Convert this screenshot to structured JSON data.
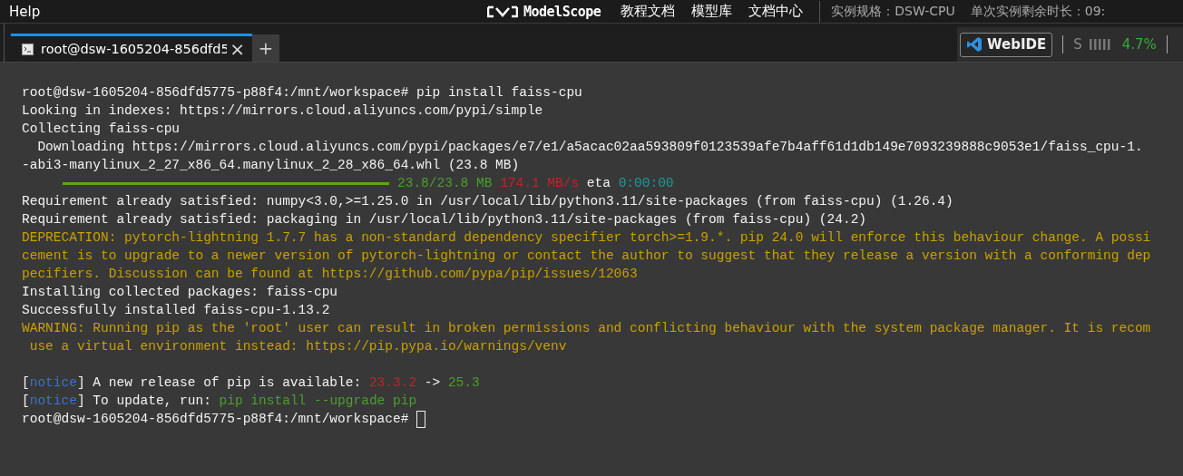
{
  "menu_bar": {
    "help": "Help",
    "logo": "ModelScope",
    "links": [
      "教程文档",
      "模型库",
      "文档中心"
    ],
    "spec": "实例规格：DSW-CPU",
    "remaining": "单次实例剩余时长：09:"
  },
  "tabs": [
    {
      "label": "root@dsw-1605204-856dfd5",
      "selected": true,
      "close": "×"
    }
  ],
  "new_tab": "+",
  "toolbar": {
    "webide": "WebIDE",
    "meter_label": "S",
    "cpu": "4.7%"
  },
  "terminal": {
    "lines": [
      {
        "kind": "text",
        "segments": [
          {
            "kind": "plain",
            "text": "root@dsw-1605204-856dfd5775-p88f4:/mnt/workspace# pip install faiss-cpu"
          }
        ]
      },
      {
        "kind": "text",
        "segments": [
          {
            "kind": "plain",
            "text": "Looking in indexes: https://mirrors.cloud.aliyuncs.com/pypi/simple"
          }
        ]
      },
      {
        "kind": "text",
        "segments": [
          {
            "kind": "plain",
            "text": "Collecting faiss-cpu"
          }
        ]
      },
      {
        "kind": "text",
        "segments": [
          {
            "kind": "plain",
            "text": "  Downloading https://mirrors.cloud.aliyuncs.com/pypi/packages/e7/e1/a5acac02aa593809f0123539afe7b4aff61d1db149e7093239888c9053e1/faiss_cpu-1."
          }
        ]
      },
      {
        "kind": "text",
        "segments": [
          {
            "kind": "plain",
            "text": "-abi3-manylinux_2_27_x86_64.manylinux_2_28_x86_64.whl (23.8 MB)"
          }
        ]
      },
      {
        "kind": "progress",
        "level": 1,
        "segments": [
          {
            "kind": "green",
            "text": "23.8/23.8 MB "
          },
          {
            "kind": "red",
            "text": "174.1 MB/s"
          },
          {
            "kind": "plain",
            "text": " eta "
          },
          {
            "kind": "teal",
            "text": "0:00:00"
          }
        ]
      },
      {
        "kind": "text",
        "segments": [
          {
            "kind": "plain",
            "text": "Requirement already satisfied: numpy<3.0,>=1.25.0 in /usr/local/lib/python3.11/site-packages (from faiss-cpu) (1.26.4)"
          }
        ]
      },
      {
        "kind": "text",
        "segments": [
          {
            "kind": "plain",
            "text": "Requirement already satisfied: packaging in /usr/local/lib/python3.11/site-packages (from faiss-cpu) (24.2)"
          }
        ]
      },
      {
        "kind": "text",
        "segments": [
          {
            "kind": "warn",
            "text": "DEPRECATION: pytorch-lightning 1.7.7 has a non-standard dependency specifier torch>=1.9.*. pip 24.0 will enforce this behaviour change. A possi"
          }
        ]
      },
      {
        "kind": "text",
        "segments": [
          {
            "kind": "warn",
            "text": "cement is to upgrade to a newer version of pytorch-lightning or contact the author to suggest that they release a version with a conforming dep"
          }
        ]
      },
      {
        "kind": "text",
        "segments": [
          {
            "kind": "warn",
            "text": "pecifiers. Discussion can be found at https://github.com/pypa/pip/issues/12063"
          }
        ]
      },
      {
        "kind": "text",
        "segments": [
          {
            "kind": "plain",
            "text": "Installing collected packages: faiss-cpu"
          }
        ]
      },
      {
        "kind": "text",
        "segments": [
          {
            "kind": "plain",
            "text": "Successfully installed faiss-cpu-1.13.2"
          }
        ]
      },
      {
        "kind": "text",
        "segments": [
          {
            "kind": "warn",
            "text": "WARNING: Running pip as the 'root' user can result in broken permissions and conflicting behaviour with the system package manager. It is recom"
          }
        ]
      },
      {
        "kind": "text",
        "segments": [
          {
            "kind": "warn",
            "text": " use a virtual environment instead: https://pip.pypa.io/warnings/venv"
          }
        ]
      },
      {
        "kind": "blank"
      },
      {
        "kind": "text",
        "segments": [
          {
            "kind": "plain",
            "text": "["
          },
          {
            "kind": "notice",
            "text": "notice"
          },
          {
            "kind": "plain",
            "text": "] A new release of pip is available: "
          },
          {
            "kind": "red",
            "text": "23.3.2"
          },
          {
            "kind": "plain",
            "text": " -> "
          },
          {
            "kind": "green",
            "text": "25.3"
          }
        ]
      },
      {
        "kind": "text",
        "segments": [
          {
            "kind": "plain",
            "text": "["
          },
          {
            "kind": "notice",
            "text": "notice"
          },
          {
            "kind": "plain",
            "text": "] To update, run: "
          },
          {
            "kind": "green",
            "text": "pip install --upgrade pip"
          }
        ]
      },
      {
        "kind": "prompt",
        "segments": [
          {
            "kind": "plain",
            "text": "root@dsw-1605204-856dfd5775-p88f4:/mnt/workspace# "
          }
        ]
      }
    ]
  }
}
